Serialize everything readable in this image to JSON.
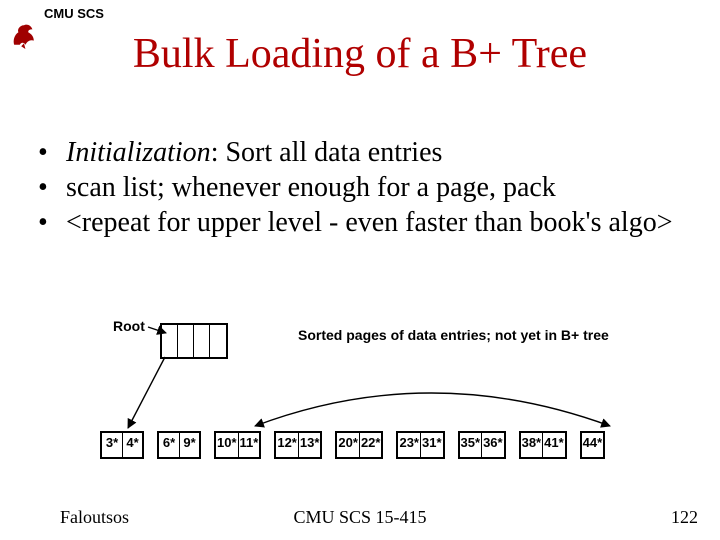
{
  "header_label": "CMU SCS",
  "title": "Bulk Loading of a B+ Tree",
  "bullets": [
    {
      "emph": "Initialization",
      "rest": ":  Sort all data entries"
    },
    {
      "emph": "",
      "rest": "scan list; whenever enough for a page, pack"
    },
    {
      "emph": "",
      "rest": "<repeat for upper level - even faster than book's algo>"
    }
  ],
  "diagram": {
    "root_label": "Root",
    "sorted_label": "Sorted pages of data entries; not yet in B+ tree",
    "root_slots": 4,
    "leaves": [
      [
        "3*",
        "4*"
      ],
      [
        "6*",
        "9*"
      ],
      [
        "10*",
        "11*"
      ],
      [
        "12*",
        "13*"
      ],
      [
        "20*",
        "22*"
      ],
      [
        "23*",
        "31*"
      ],
      [
        "35*",
        "36*"
      ],
      [
        "38*",
        "41*"
      ],
      [
        "44*"
      ]
    ]
  },
  "footer": {
    "left": "Faloutsos",
    "center": "CMU SCS 15-415",
    "right": "122"
  },
  "colors": {
    "title": "#b00000",
    "logo": "#a00000"
  }
}
